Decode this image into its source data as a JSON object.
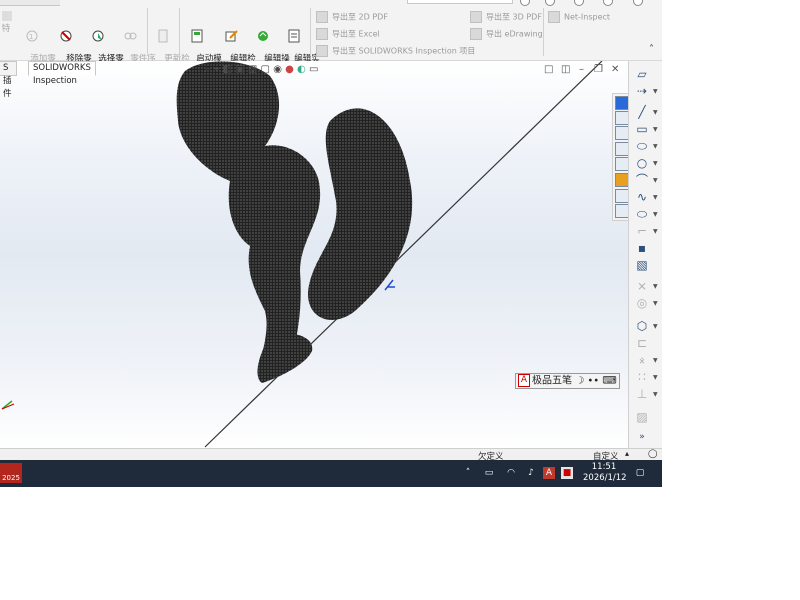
{
  "ribbon": {
    "buttons": [
      {
        "label": "特",
        "disabled": true
      },
      {
        "label": "添加零\n组件序\n序号",
        "disabled": true
      },
      {
        "label": "移除零\n件序号",
        "disabled": false
      },
      {
        "label": "选择零\n件序号",
        "disabled": false
      },
      {
        "label": "零件序\n号排列",
        "disabled": true
      },
      {
        "label": "更新检\n查项目",
        "disabled": true
      },
      {
        "label": "启动模\n板编辑\n器",
        "disabled": false
      },
      {
        "label": "编辑检\n查方式",
        "disabled": false
      },
      {
        "label": "编辑操\n作",
        "disabled": false
      },
      {
        "label": "编辑实\n方",
        "disabled": false
      }
    ],
    "export_items": [
      "导出至 2D PDF",
      "导出至 Excel",
      "导出至 SOLIDWORKS Inspection 项目",
      "导出至 3D PDF",
      "导出 eDrawing",
      "Net-Inspect"
    ],
    "collapse_icon": "chevron-up-icon"
  },
  "tabs": [
    "S 插件",
    "SOLIDWORKS Inspection"
  ],
  "ime": {
    "label": "极品五笔"
  },
  "status": {
    "left": "欠定义",
    "right": "自定义"
  },
  "taskbar": {
    "app_badge": "2025",
    "time": "11:51",
    "date": "2026/1/12",
    "ime_char": "A"
  },
  "colors": {
    "accent": "#2c4f7c",
    "taskbar": "#1f2b3a"
  }
}
